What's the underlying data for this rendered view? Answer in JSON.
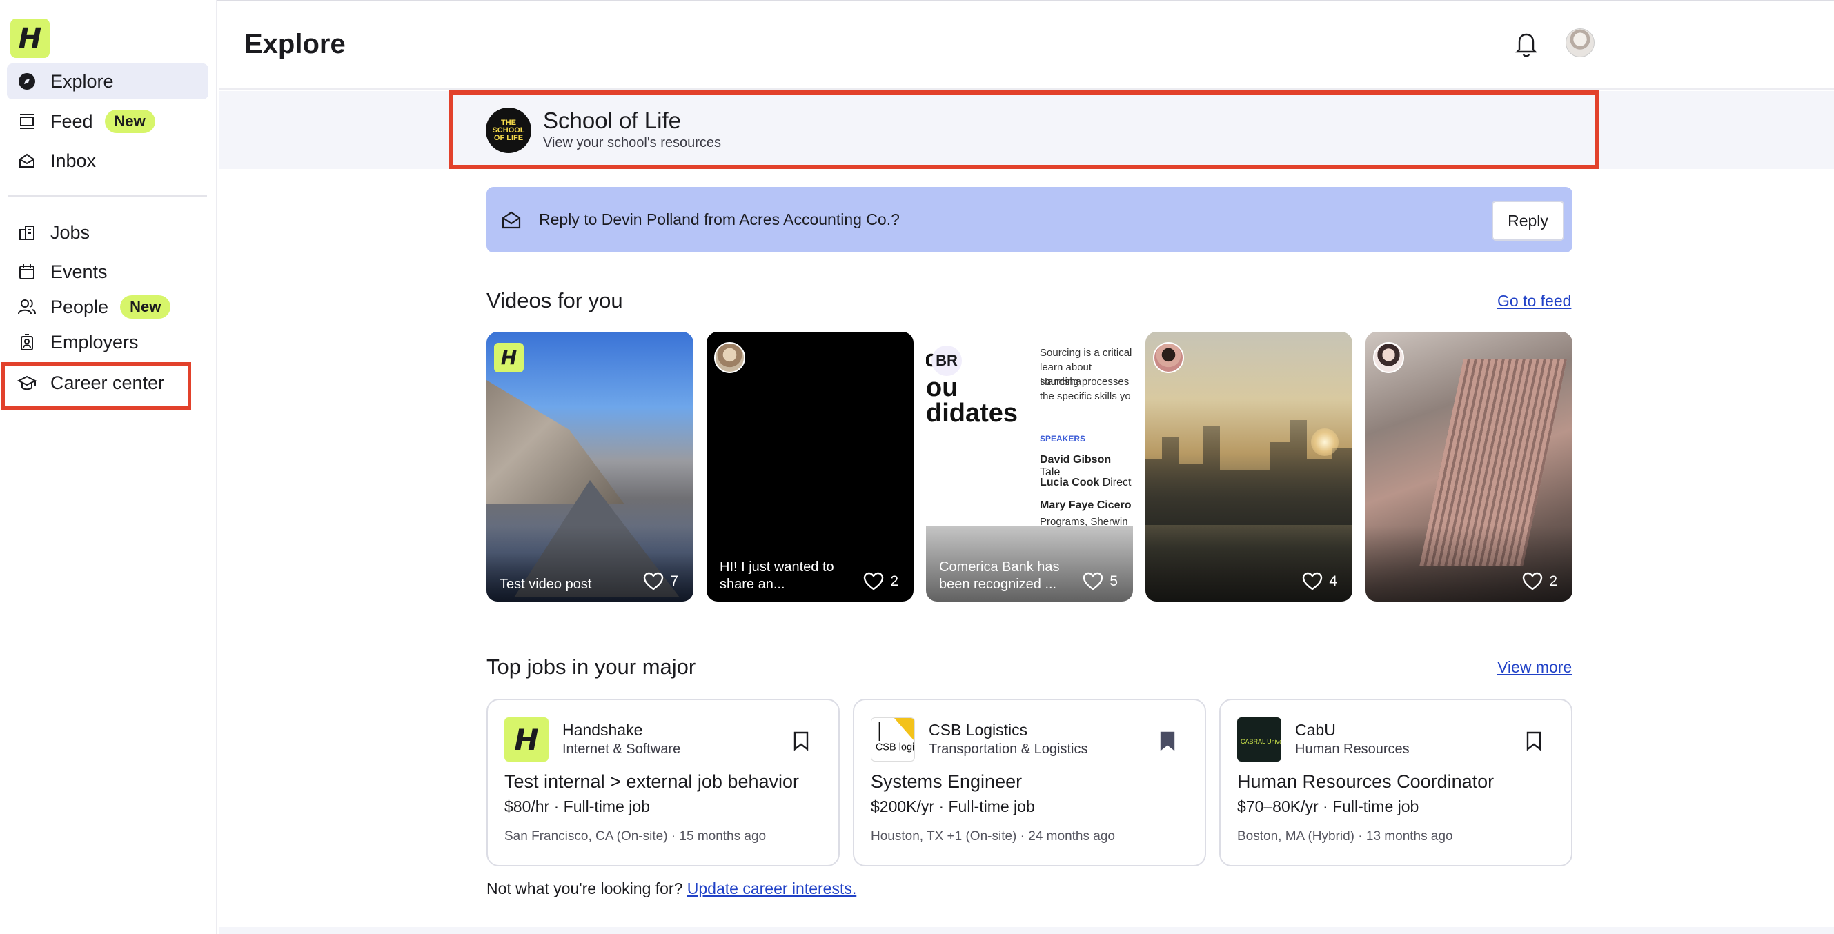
{
  "sidebar": {
    "logo_letter": "H",
    "items": [
      {
        "label": "Explore",
        "icon": "compass-icon",
        "active": true
      },
      {
        "label": "Feed",
        "icon": "feed-icon",
        "badge": "New"
      },
      {
        "label": "Inbox",
        "icon": "inbox-icon"
      },
      {
        "label": "Jobs",
        "icon": "briefcase-icon"
      },
      {
        "label": "Events",
        "icon": "calendar-icon"
      },
      {
        "label": "People",
        "icon": "people-icon",
        "badge": "New"
      },
      {
        "label": "Employers",
        "icon": "building-icon"
      },
      {
        "label": "Career center",
        "icon": "graduation-cap-icon"
      }
    ]
  },
  "header": {
    "title": "Explore"
  },
  "school": {
    "logo_text": "THE SCHOOL OF LIFE",
    "name": "School of Life",
    "subtitle": "View your school's resources"
  },
  "reply_banner": {
    "text": "Reply to Devin Polland from Acres Accounting Co.?",
    "button": "Reply"
  },
  "videos_section": {
    "title": "Videos for you",
    "link": "Go to feed",
    "videos": [
      {
        "caption": "Test video post",
        "likes": "7"
      },
      {
        "caption": "HI! I just wanted to share an...",
        "likes": "2"
      },
      {
        "caption": "Comerica Bank has been recognized ...",
        "likes": "5"
      },
      {
        "caption": "",
        "likes": "4"
      },
      {
        "caption": "",
        "likes": "2"
      }
    ],
    "v3_overlay": {
      "badge": "BR",
      "big1": "c",
      "big2": "ou",
      "big3": "didates",
      "intro": [
        "Sourcing is a critical",
        "learn about Handsha",
        "sourcing processes",
        "the specific skills yo"
      ],
      "speakers_label": "SPEAKERS",
      "speakers": [
        {
          "name": "David Gibson",
          "role": "Tale"
        },
        {
          "name": "Lucia Cook",
          "role": "Direct"
        },
        {
          "name": "Mary Faye Cicero",
          "role": ""
        }
      ],
      "speakers_tail": "Programs, Sherwin"
    }
  },
  "jobs_section": {
    "title": "Top jobs in your major",
    "link": "View more",
    "jobs": [
      {
        "logo": "H",
        "company": "Handshake",
        "industry": "Internet & Software",
        "title": "Test internal > external job behavior",
        "pay": "$80/hr · Full-time job",
        "meta": "San Francisco, CA (On-site) · 15 months ago",
        "saved": false
      },
      {
        "logo": "CSB logistics",
        "company": "CSB Logistics",
        "industry": "Transportation & Logistics",
        "title": "Systems Engineer",
        "pay": "$200K/yr · Full-time job",
        "meta": "Houston, TX +1 (On-site) · 24 months ago",
        "saved": true
      },
      {
        "logo": "CABRAL University Employment",
        "company": "CabU",
        "industry": "Human Resources",
        "title": "Human Resources Coordinator",
        "pay": "$70–80K/yr · Full-time job",
        "meta": "Boston, MA (Hybrid) · 13 months ago",
        "saved": false
      }
    ],
    "footer_text": "Not what you're looking for?",
    "footer_link": "Update career interests."
  },
  "colors": {
    "accent_lime": "#d7f56a",
    "highlight_red": "#e2412b",
    "reply_bar": "#b6c4f7",
    "link_blue": "#2142c7"
  }
}
